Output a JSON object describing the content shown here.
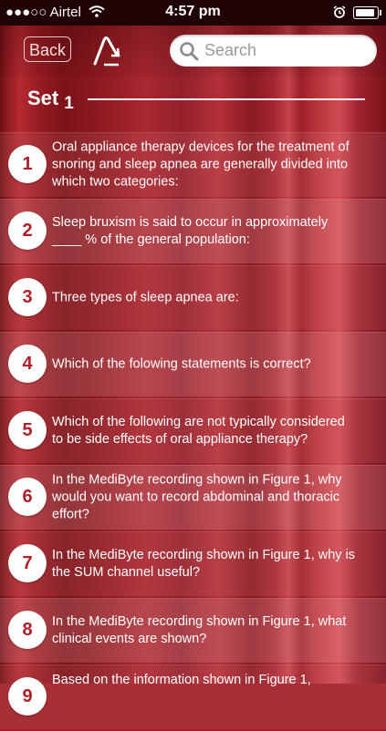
{
  "status_bar": {
    "carrier": "●●●○○ Airtel",
    "time": "4:57 pm"
  },
  "nav": {
    "back_label": "Back",
    "search_placeholder": "Search"
  },
  "set": {
    "label": "Set",
    "number": "1"
  },
  "questions": [
    {
      "number": "1",
      "text": "Oral appliance therapy devices for the treatment of snoring and sleep apnea are generally divided into which two categories:"
    },
    {
      "number": "2",
      "text": "Sleep bruxism is said to occur in approximately ____ % of the general population:"
    },
    {
      "number": "3",
      "text": "Three types of sleep apnea are:"
    },
    {
      "number": "4",
      "text": "Which of the folowing statements is correct?"
    },
    {
      "number": "5",
      "text": "Which of the following are not typically considered to be side effects of oral appliance therapy?"
    },
    {
      "number": "6",
      "text": "In the MediByte recording shown in Figure 1, why would you want to record abdominal and thoracic effort?"
    },
    {
      "number": "7",
      "text": " In the MediByte recording shown in Figure 1, why is the SUM channel useful?"
    },
    {
      "number": "8",
      "text": "In the MediByte recording shown in Figure 1, what clinical events are shown?"
    },
    {
      "number": "9",
      "text": "Based on the information shown in Figure 1,"
    }
  ],
  "colors": {
    "accent": "#b01f28",
    "background": "#a01f26"
  }
}
